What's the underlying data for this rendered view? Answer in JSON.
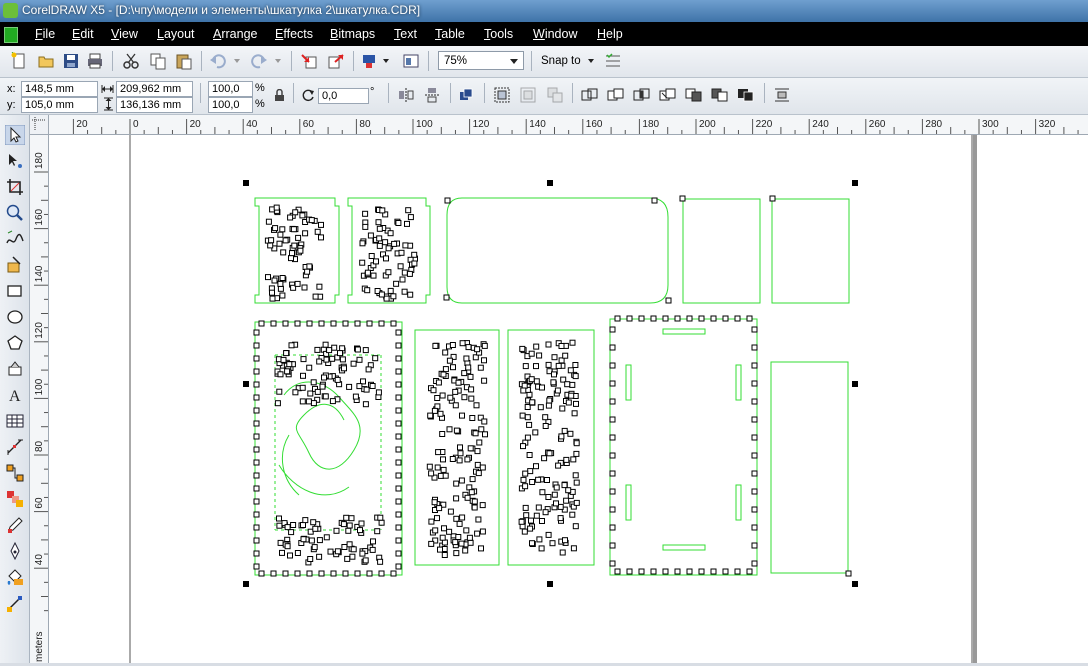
{
  "window": {
    "title": "CorelDRAW X5 - [D:\\чпу\\модели и элементы\\шкатулка 2\\шкатулка.CDR]"
  },
  "menu": [
    "File",
    "Edit",
    "View",
    "Layout",
    "Arrange",
    "Effects",
    "Bitmaps",
    "Text",
    "Table",
    "Tools",
    "Window",
    "Help"
  ],
  "toolbar": {
    "zoom": "75%",
    "snap_to": "Snap to"
  },
  "property_bar": {
    "x_label": "x:",
    "x_value": "148,5 mm",
    "y_label": "y:",
    "y_value": "105,0 mm",
    "width_value": "209,962 mm",
    "height_value": "136,136 mm",
    "scale_x": "100,0",
    "scale_y": "100,0",
    "percent": "%",
    "rotation_value": "0,0",
    "degree": "°"
  },
  "rulers": {
    "horizontal_ticks": [
      "20",
      "0",
      "20",
      "40",
      "60",
      "80",
      "100",
      "120",
      "140",
      "160",
      "180",
      "200",
      "220",
      "240",
      "260",
      "280",
      "300",
      "320"
    ],
    "vertical_ticks": [
      "180",
      "160",
      "140",
      "120",
      "100",
      "80",
      "60",
      "40"
    ],
    "unit_label": "meters"
  },
  "colors": {
    "outline_green": "#33dd33",
    "menubar_bg": "#000000",
    "titlebar_bg": "#4f83b8"
  }
}
